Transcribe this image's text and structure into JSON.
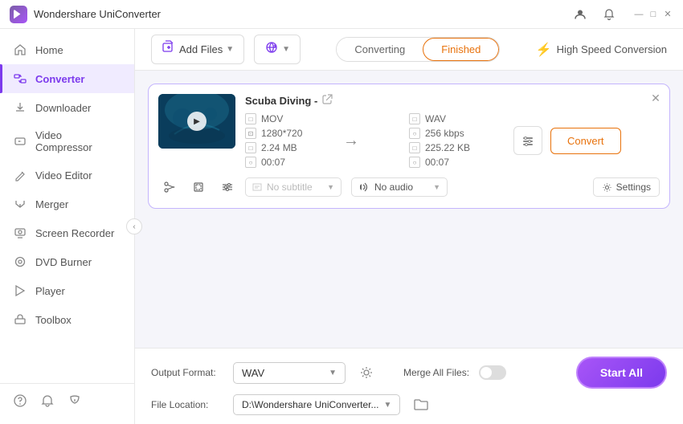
{
  "titleBar": {
    "appName": "Wondershare UniConverter",
    "icons": {
      "user": "👤",
      "bell": "🔔",
      "minimize": "—",
      "maximize": "□",
      "close": "✕"
    }
  },
  "sidebar": {
    "items": [
      {
        "id": "home",
        "label": "Home",
        "icon": "🏠"
      },
      {
        "id": "converter",
        "label": "Converter",
        "icon": "⚡",
        "active": true
      },
      {
        "id": "downloader",
        "label": "Downloader",
        "icon": "⬇"
      },
      {
        "id": "video-compressor",
        "label": "Video Compressor",
        "icon": "📦"
      },
      {
        "id": "video-editor",
        "label": "Video Editor",
        "icon": "✂"
      },
      {
        "id": "merger",
        "label": "Merger",
        "icon": "🔗"
      },
      {
        "id": "screen-recorder",
        "label": "Screen Recorder",
        "icon": "⏺"
      },
      {
        "id": "dvd-burner",
        "label": "DVD Burner",
        "icon": "💿"
      },
      {
        "id": "player",
        "label": "Player",
        "icon": "▶"
      },
      {
        "id": "toolbox",
        "label": "Toolbox",
        "icon": "🧰"
      }
    ],
    "bottomItems": [
      {
        "id": "help",
        "icon": "❓"
      },
      {
        "id": "notifications",
        "icon": "🔔"
      },
      {
        "id": "refresh",
        "icon": "🔄"
      }
    ]
  },
  "toolbar": {
    "addFileLabel": "Add Files",
    "addUrlLabel": "Add URL",
    "tabs": [
      {
        "id": "converting",
        "label": "Converting"
      },
      {
        "id": "finished",
        "label": "Finished",
        "active": true
      }
    ],
    "speedConversion": "High Speed Conversion"
  },
  "fileCard": {
    "title": "Scuba Diving -",
    "inputFormat": "MOV",
    "inputResolution": "1280*720",
    "inputSize": "2.24 MB",
    "inputDuration": "00:07",
    "outputFormat": "WAV",
    "outputBitrate": "256 kbps",
    "outputSize": "225.22 KB",
    "outputDuration": "00:07",
    "convertBtnLabel": "Convert",
    "subtitlePlaceholder": "No subtitle",
    "audioPlaceholder": "No audio",
    "settingsBtnLabel": "Settings"
  },
  "bottomBar": {
    "outputFormatLabel": "Output Format:",
    "outputFormat": "WAV",
    "fileLocationLabel": "File Location:",
    "fileLocation": "D:\\Wondershare UniConverter...",
    "mergeAllFilesLabel": "Merge All Files:",
    "startAllLabel": "Start All"
  }
}
